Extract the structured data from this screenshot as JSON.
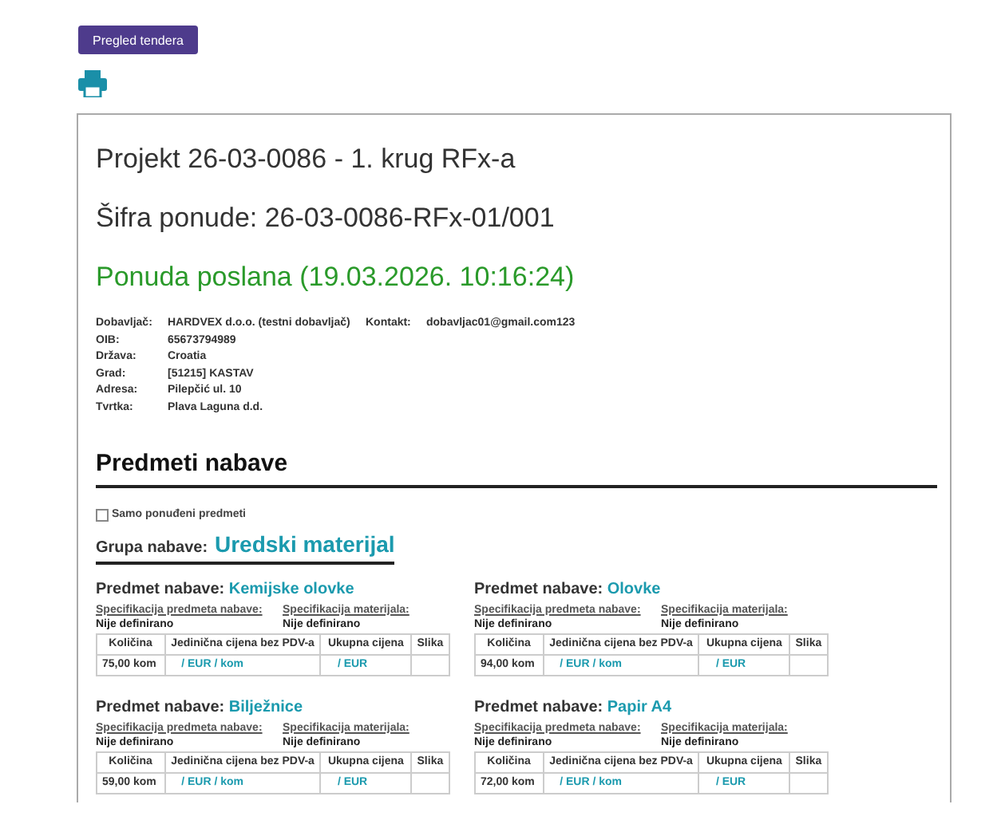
{
  "button": {
    "label": "Pregled tendera"
  },
  "title": "Projekt 26-03-0086 - 1. krug RFx-a",
  "offer_code": "Šifra ponude: 26-03-0086-RFx-01/001",
  "status": "Ponuda poslana (19.03.2026. 10:16:24)",
  "supplier": [
    {
      "label": "Dobavljač:",
      "value": "HARDVEX d.o.o. (testni dobavljač)"
    },
    {
      "label": "OIB:",
      "value": "65673794989"
    },
    {
      "label": "Država:",
      "value": "Croatia"
    },
    {
      "label": "Grad:",
      "value": "[51215] KASTAV"
    },
    {
      "label": "Adresa:",
      "value": "Pilepčić ul. 10"
    },
    {
      "label": "Tvrtka:",
      "value": "Plava Laguna d.d."
    }
  ],
  "contact": {
    "label": "Kontakt:",
    "value": "dobavljac01@gmail.com123"
  },
  "section_title": "Predmeti nabave",
  "filter": {
    "label": "Samo ponuđeni predmeti",
    "checked": false
  },
  "group": {
    "label": "Grupa nabave:",
    "name": "Uredski materijal"
  },
  "items": [
    {
      "label": "Predmet nabave:",
      "name": "Kemijske olovke",
      "spec_item_label": "Specifikacija predmeta nabave:",
      "spec_item_value": "Nije definirano",
      "spec_material_label": "Specifikacija materijala:",
      "spec_material_value": "Nije definirano",
      "columns": [
        "Količina",
        "Jedinična cijena bez PDV-a",
        "Ukupna cijena",
        "Slika"
      ],
      "quantity": "75,00 kom",
      "unit_price": "/ EUR / kom",
      "total": "/ EUR"
    },
    {
      "label": "Predmet nabave:",
      "name": "Olovke",
      "spec_item_label": "Specifikacija predmeta nabave:",
      "spec_item_value": "Nije definirano",
      "spec_material_label": "Specifikacija materijala:",
      "spec_material_value": "Nije definirano",
      "columns": [
        "Količina",
        "Jedinična cijena bez PDV-a",
        "Ukupna cijena",
        "Slika"
      ],
      "quantity": "94,00 kom",
      "unit_price": "/ EUR / kom",
      "total": "/ EUR"
    },
    {
      "label": "Predmet nabave:",
      "name": "Bilježnice",
      "spec_item_label": "Specifikacija predmeta nabave:",
      "spec_item_value": "Nije definirano",
      "spec_material_label": "Specifikacija materijala:",
      "spec_material_value": "Nije definirano",
      "columns": [
        "Količina",
        "Jedinična cijena bez PDV-a",
        "Ukupna cijena",
        "Slika"
      ],
      "quantity": "59,00 kom",
      "unit_price": "/ EUR / kom",
      "total": "/ EUR"
    },
    {
      "label": "Predmet nabave:",
      "name": "Papir A4",
      "spec_item_label": "Specifikacija predmeta nabave:",
      "spec_item_value": "Nije definirano",
      "spec_material_label": "Specifikacija materijala:",
      "spec_material_value": "Nije definirano",
      "columns": [
        "Količina",
        "Jedinična cijena bez PDV-a",
        "Ukupna cijena",
        "Slika"
      ],
      "quantity": "72,00 kom",
      "unit_price": "/ EUR / kom",
      "total": "/ EUR"
    }
  ]
}
